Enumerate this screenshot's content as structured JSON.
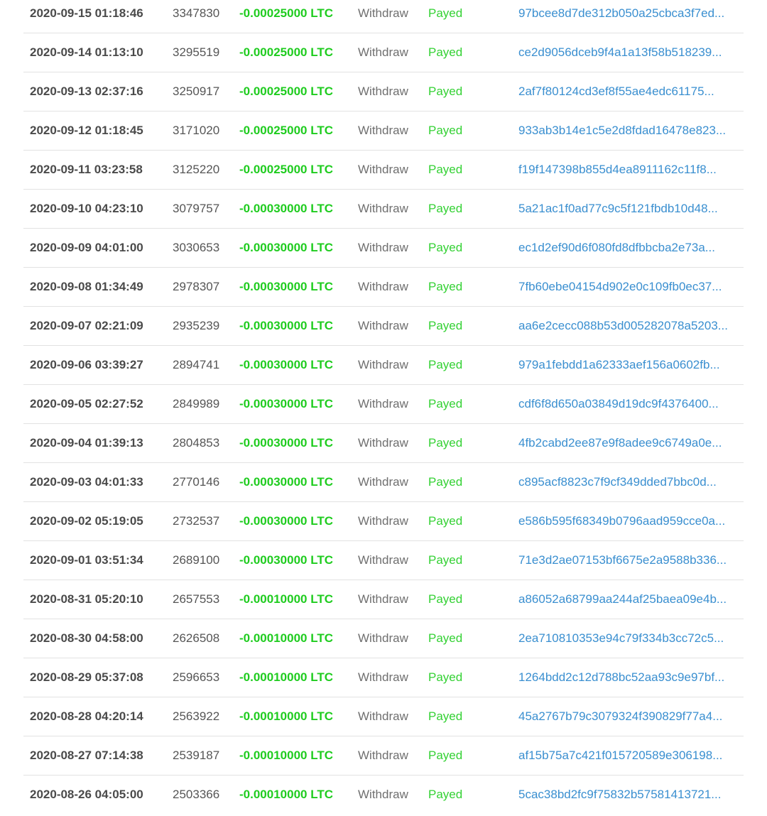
{
  "transactions": [
    {
      "date": "2020-09-15 01:18:46",
      "id": "3347830",
      "amount": "-0.00025000 LTC",
      "type": "Withdraw",
      "status": "Payed",
      "hash": "97bcee8d7de312b050a25cbca3f7ed..."
    },
    {
      "date": "2020-09-14 01:13:10",
      "id": "3295519",
      "amount": "-0.00025000 LTC",
      "type": "Withdraw",
      "status": "Payed",
      "hash": "ce2d9056dceb9f4a1a13f58b518239..."
    },
    {
      "date": "2020-09-13 02:37:16",
      "id": "3250917",
      "amount": "-0.00025000 LTC",
      "type": "Withdraw",
      "status": "Payed",
      "hash": "2af7f80124cd3ef8f55ae4edc61175..."
    },
    {
      "date": "2020-09-12 01:18:45",
      "id": "3171020",
      "amount": "-0.00025000 LTC",
      "type": "Withdraw",
      "status": "Payed",
      "hash": "933ab3b14e1c5e2d8fdad16478e823..."
    },
    {
      "date": "2020-09-11 03:23:58",
      "id": "3125220",
      "amount": "-0.00025000 LTC",
      "type": "Withdraw",
      "status": "Payed",
      "hash": "f19f147398b855d4ea8911162c11f8..."
    },
    {
      "date": "2020-09-10 04:23:10",
      "id": "3079757",
      "amount": "-0.00030000 LTC",
      "type": "Withdraw",
      "status": "Payed",
      "hash": "5a21ac1f0ad77c9c5f121fbdb10d48..."
    },
    {
      "date": "2020-09-09 04:01:00",
      "id": "3030653",
      "amount": "-0.00030000 LTC",
      "type": "Withdraw",
      "status": "Payed",
      "hash": "ec1d2ef90d6f080fd8dfbbcba2e73a..."
    },
    {
      "date": "2020-09-08 01:34:49",
      "id": "2978307",
      "amount": "-0.00030000 LTC",
      "type": "Withdraw",
      "status": "Payed",
      "hash": "7fb60ebe04154d902e0c109fb0ec37..."
    },
    {
      "date": "2020-09-07 02:21:09",
      "id": "2935239",
      "amount": "-0.00030000 LTC",
      "type": "Withdraw",
      "status": "Payed",
      "hash": "aa6e2cecc088b53d005282078a5203..."
    },
    {
      "date": "2020-09-06 03:39:27",
      "id": "2894741",
      "amount": "-0.00030000 LTC",
      "type": "Withdraw",
      "status": "Payed",
      "hash": "979a1febdd1a62333aef156a0602fb..."
    },
    {
      "date": "2020-09-05 02:27:52",
      "id": "2849989",
      "amount": "-0.00030000 LTC",
      "type": "Withdraw",
      "status": "Payed",
      "hash": "cdf6f8d650a03849d19dc9f4376400..."
    },
    {
      "date": "2020-09-04 01:39:13",
      "id": "2804853",
      "amount": "-0.00030000 LTC",
      "type": "Withdraw",
      "status": "Payed",
      "hash": "4fb2cabd2ee87e9f8adee9c6749a0e..."
    },
    {
      "date": "2020-09-03 04:01:33",
      "id": "2770146",
      "amount": "-0.00030000 LTC",
      "type": "Withdraw",
      "status": "Payed",
      "hash": "c895acf8823c7f9cf349dded7bbc0d..."
    },
    {
      "date": "2020-09-02 05:19:05",
      "id": "2732537",
      "amount": "-0.00030000 LTC",
      "type": "Withdraw",
      "status": "Payed",
      "hash": "e586b595f68349b0796aad959cce0a..."
    },
    {
      "date": "2020-09-01 03:51:34",
      "id": "2689100",
      "amount": "-0.00030000 LTC",
      "type": "Withdraw",
      "status": "Payed",
      "hash": "71e3d2ae07153bf6675e2a9588b336..."
    },
    {
      "date": "2020-08-31 05:20:10",
      "id": "2657553",
      "amount": "-0.00010000 LTC",
      "type": "Withdraw",
      "status": "Payed",
      "hash": "a86052a68799aa244af25baea09e4b..."
    },
    {
      "date": "2020-08-30 04:58:00",
      "id": "2626508",
      "amount": "-0.00010000 LTC",
      "type": "Withdraw",
      "status": "Payed",
      "hash": "2ea710810353e94c79f334b3cc72c5..."
    },
    {
      "date": "2020-08-29 05:37:08",
      "id": "2596653",
      "amount": "-0.00010000 LTC",
      "type": "Withdraw",
      "status": "Payed",
      "hash": "1264bdd2c12d788bc52aa93c9e97bf..."
    },
    {
      "date": "2020-08-28 04:20:14",
      "id": "2563922",
      "amount": "-0.00010000 LTC",
      "type": "Withdraw",
      "status": "Payed",
      "hash": "45a2767b79c3079324f390829f77a4..."
    },
    {
      "date": "2020-08-27 07:14:38",
      "id": "2539187",
      "amount": "-0.00010000 LTC",
      "type": "Withdraw",
      "status": "Payed",
      "hash": "af15b75a7c421f015720589e306198..."
    },
    {
      "date": "2020-08-26 04:05:00",
      "id": "2503366",
      "amount": "-0.00010000 LTC",
      "type": "Withdraw",
      "status": "Payed",
      "hash": "5cac38bd2fc9f75832b57581413721..."
    }
  ],
  "colors": {
    "amount": "#1fcc1f",
    "status": "#33d133",
    "hash_link": "#3a8fd0",
    "divider": "#e2e2e2"
  }
}
